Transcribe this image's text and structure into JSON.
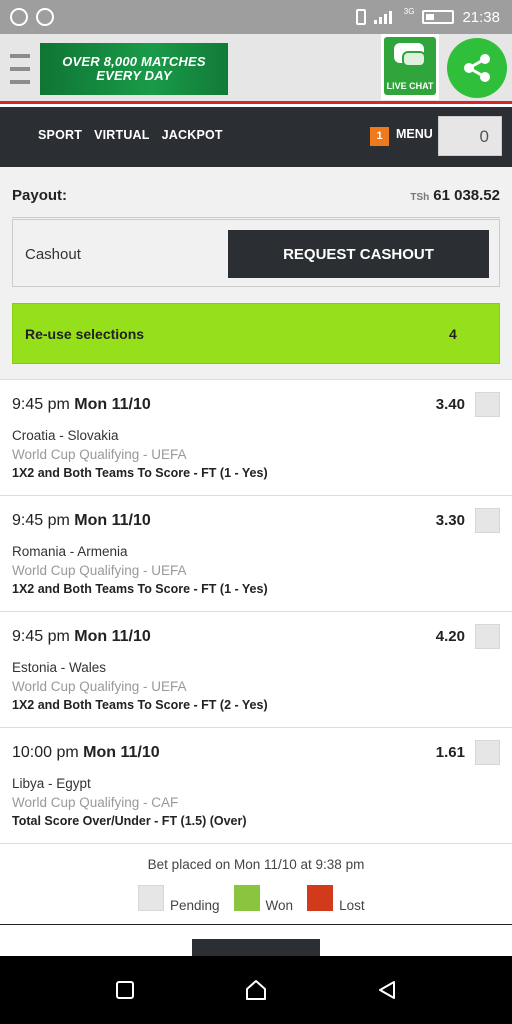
{
  "status_bar": {
    "time": "21:38",
    "network": "3G",
    "icons": [
      "chat-bubble-icon",
      "chrome-icon",
      "vibrate-icon",
      "signal-icon",
      "battery-icon"
    ]
  },
  "header": {
    "banner_line1": "OVER 8,000 MATCHES",
    "banner_line2": "EVERY DAY",
    "live_chat_label": "LIVE CHAT",
    "share_icon": "share-icon"
  },
  "nav": {
    "links": [
      "SPORT",
      "VIRTUAL",
      "JACKPOT"
    ],
    "menu_badge": "1",
    "menu_label": "MENU",
    "bet_count": "0"
  },
  "payout": {
    "label": "Payout:",
    "currency": "TSh",
    "amount": "61 038.52"
  },
  "cashout": {
    "label": "Cashout",
    "button": "REQUEST CASHOUT"
  },
  "reuse": {
    "label": "Re-use selections",
    "count": "4"
  },
  "selections": [
    {
      "time": "9:45 pm",
      "date": "Mon 11/10",
      "odds": "3.40",
      "match": "Croatia - Slovakia",
      "competition": "World Cup Qualifying - UEFA",
      "market": "1X2 and Both Teams To Score - FT (1 - Yes)",
      "status": "pending"
    },
    {
      "time": "9:45 pm",
      "date": "Mon 11/10",
      "odds": "3.30",
      "match": "Romania - Armenia",
      "competition": "World Cup Qualifying - UEFA",
      "market": "1X2 and Both Teams To Score - FT (1 - Yes)",
      "status": "pending"
    },
    {
      "time": "9:45 pm",
      "date": "Mon 11/10",
      "odds": "4.20",
      "match": "Estonia - Wales",
      "competition": "World Cup Qualifying - UEFA",
      "market": "1X2 and Both Teams To Score - FT (2 - Yes)",
      "status": "pending"
    },
    {
      "time": "10:00 pm",
      "date": "Mon 11/10",
      "odds": "1.61",
      "match": "Libya - Egypt",
      "competition": "World Cup Qualifying - CAF",
      "market": "Total Score Over/Under - FT (1.5) (Over)",
      "status": "pending"
    }
  ],
  "bet_placed": "Bet placed on Mon 11/10 at 9:38 pm",
  "legend": [
    {
      "label": "Pending",
      "color": "#e6e6e6"
    },
    {
      "label": "Won",
      "color": "#8bc53f"
    },
    {
      "label": "Lost",
      "color": "#d23a1c"
    }
  ],
  "colors": {
    "accent_green": "#95e01a",
    "dark": "#2b2f33",
    "header_red_line": "#d8242b",
    "menu_badge": "#f07a1b"
  }
}
